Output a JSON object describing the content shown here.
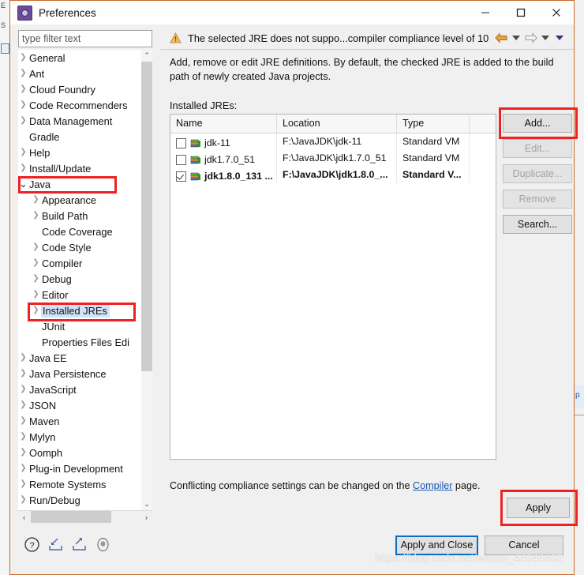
{
  "background": {
    "left_letters": [
      "E",
      "S"
    ],
    "right_fragment": "p"
  },
  "window": {
    "title": "Preferences",
    "app_icon": "eclipse-preferences-icon",
    "minimize": "–",
    "maximize": "☐",
    "close": "✕"
  },
  "filter": {
    "placeholder": "type filter text",
    "value": ""
  },
  "tree": {
    "items": [
      {
        "label": "General",
        "level": 1,
        "arrow": "right",
        "selected": false
      },
      {
        "label": "Ant",
        "level": 1,
        "arrow": "right",
        "selected": false
      },
      {
        "label": "Cloud Foundry",
        "level": 1,
        "arrow": "right",
        "selected": false
      },
      {
        "label": "Code Recommenders",
        "level": 1,
        "arrow": "right",
        "selected": false
      },
      {
        "label": "Data Management",
        "level": 1,
        "arrow": "right",
        "selected": false
      },
      {
        "label": "Gradle",
        "level": 1,
        "arrow": "none",
        "selected": false
      },
      {
        "label": "Help",
        "level": 1,
        "arrow": "right",
        "selected": false
      },
      {
        "label": "Install/Update",
        "level": 1,
        "arrow": "right",
        "selected": false
      },
      {
        "label": "Java",
        "level": 1,
        "arrow": "down",
        "selected": false
      },
      {
        "label": "Appearance",
        "level": 2,
        "arrow": "right",
        "selected": false
      },
      {
        "label": "Build Path",
        "level": 2,
        "arrow": "right",
        "selected": false
      },
      {
        "label": "Code Coverage",
        "level": 2,
        "arrow": "none",
        "selected": false
      },
      {
        "label": "Code Style",
        "level": 2,
        "arrow": "right",
        "selected": false
      },
      {
        "label": "Compiler",
        "level": 2,
        "arrow": "right",
        "selected": false
      },
      {
        "label": "Debug",
        "level": 2,
        "arrow": "right",
        "selected": false
      },
      {
        "label": "Editor",
        "level": 2,
        "arrow": "right",
        "selected": false
      },
      {
        "label": "Installed JREs",
        "level": 2,
        "arrow": "right",
        "selected": true
      },
      {
        "label": "JUnit",
        "level": 2,
        "arrow": "none",
        "selected": false
      },
      {
        "label": "Properties Files Edi",
        "level": 2,
        "arrow": "none",
        "selected": false
      },
      {
        "label": "Java EE",
        "level": 1,
        "arrow": "right",
        "selected": false
      },
      {
        "label": "Java Persistence",
        "level": 1,
        "arrow": "right",
        "selected": false
      },
      {
        "label": "JavaScript",
        "level": 1,
        "arrow": "right",
        "selected": false
      },
      {
        "label": "JSON",
        "level": 1,
        "arrow": "right",
        "selected": false
      },
      {
        "label": "Maven",
        "level": 1,
        "arrow": "right",
        "selected": false
      },
      {
        "label": "Mylyn",
        "level": 1,
        "arrow": "right",
        "selected": false
      },
      {
        "label": "Oomph",
        "level": 1,
        "arrow": "right",
        "selected": false
      },
      {
        "label": "Plug-in Development",
        "level": 1,
        "arrow": "right",
        "selected": false
      },
      {
        "label": "Remote Systems",
        "level": 1,
        "arrow": "right",
        "selected": false
      },
      {
        "label": "Run/Debug",
        "level": 1,
        "arrow": "right",
        "selected": false
      }
    ],
    "scroll_up": "⌃",
    "scroll_down": "⌄",
    "scroll_left": "‹",
    "scroll_right": "›"
  },
  "message_bar": {
    "icon": "warning-icon",
    "text": "The selected JRE does not suppo...compiler compliance level of 10",
    "back_arrow": "back-arrow-icon",
    "forward_arrow": "forward-arrow-icon",
    "caret": "▾"
  },
  "page": {
    "description": "Add, remove or edit JRE definitions. By default, the checked JRE is added to the build path of newly created Java projects.",
    "installed_label": "Installed JREs:"
  },
  "table": {
    "columns": [
      "Name",
      "Location",
      "Type",
      ""
    ],
    "rows": [
      {
        "checked": false,
        "name": "jdk-11",
        "location": "F:\\JavaJDK\\jdk-11",
        "type": "Standard VM",
        "bold": false
      },
      {
        "checked": false,
        "name": "jdk1.7.0_51",
        "location": "F:\\JavaJDK\\jdk1.7.0_51",
        "type": "Standard VM",
        "bold": false
      },
      {
        "checked": true,
        "name": "jdk1.8.0_131 ...",
        "location": "F:\\JavaJDK\\jdk1.8.0_...",
        "type": "Standard V...",
        "bold": true
      }
    ]
  },
  "side_buttons": [
    {
      "label": "Add...",
      "enabled": true
    },
    {
      "label": "Edit...",
      "enabled": false
    },
    {
      "label": "Duplicate...",
      "enabled": false
    },
    {
      "label": "Remove",
      "enabled": false
    },
    {
      "label": "Search...",
      "enabled": true
    }
  ],
  "note": {
    "prefix": "Conflicting compliance settings can be changed on the ",
    "link": "Compiler",
    "suffix": " page."
  },
  "apply_button": "Apply",
  "footer": {
    "help_icon": "help-icon",
    "import_icon": "import-icon",
    "export_icon": "export-icon",
    "restore_icon": "restore-defaults-icon",
    "apply_and_close": "Apply and Close",
    "cancel": "Cancel"
  },
  "watermark": "https://blog.csdn.net/weixin_44644403",
  "colors": {
    "dialog_border": "#c96a2b",
    "highlight_red": "#ee2222",
    "selection_blue": "#cfe4f7",
    "focus_blue": "#0b6ec6",
    "link_blue": "#1a55b4",
    "warning_gold": "#e8a33d"
  }
}
